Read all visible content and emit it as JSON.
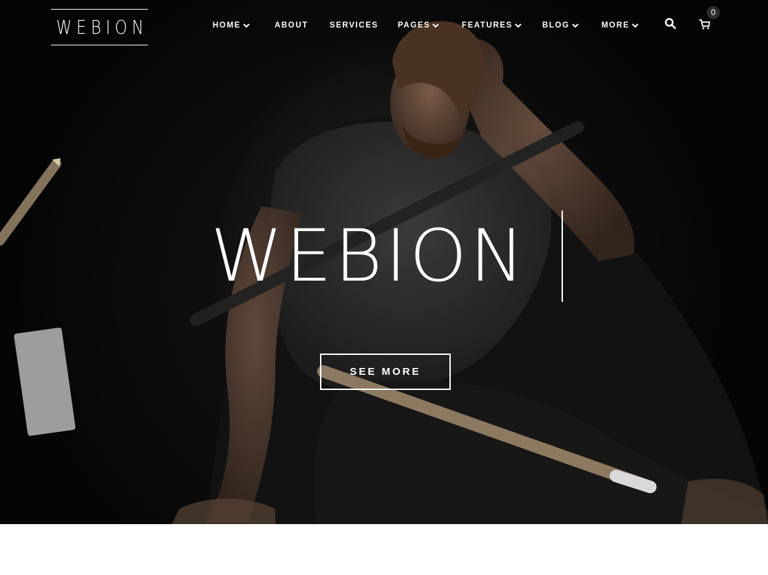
{
  "brand": {
    "logo_text": "WEBION"
  },
  "nav": {
    "items": [
      {
        "label": "HOME",
        "has_dropdown": true
      },
      {
        "label": "ABOUT",
        "has_dropdown": false
      },
      {
        "label": "SERVICES",
        "has_dropdown": false
      },
      {
        "label": "PAGES",
        "has_dropdown": true
      },
      {
        "label": "FEATURES",
        "has_dropdown": true
      },
      {
        "label": "BLOG",
        "has_dropdown": true
      },
      {
        "label": "MORE",
        "has_dropdown": true
      }
    ],
    "search_icon": "search-icon",
    "cart_icon": "cart-icon",
    "cart_count": "0"
  },
  "hero": {
    "title": "WEBION",
    "button_label": "SEE MORE"
  },
  "colors": {
    "text": "#ffffff",
    "background_dark": "#0b0b0b",
    "page_background": "#ffffff"
  }
}
